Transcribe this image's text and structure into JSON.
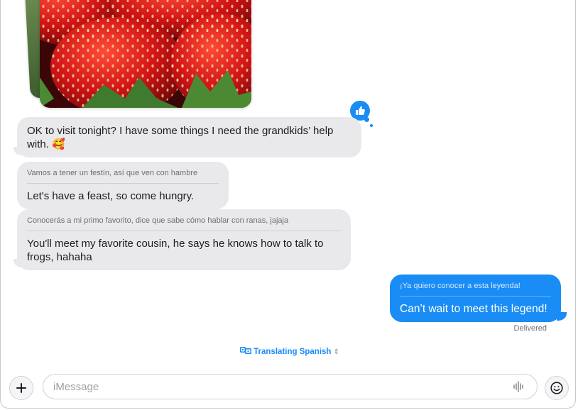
{
  "conversation": {
    "messages": [
      {
        "direction": "incoming",
        "text": "OK to visit tonight? I have some things I need the grandkids’ help with.",
        "emoji": "🥰"
      },
      {
        "direction": "incoming",
        "original": "Vamos a tener un festín, así que ven con hambre",
        "translation": "Let's have a feast, so come hungry."
      },
      {
        "direction": "incoming",
        "original": "Conocerás a mi primo favorito, dice que sabe cómo hablar con ranas, jajaja",
        "translation": "You'll meet my favorite cousin, he says he knows how to talk to frogs, hahaha"
      },
      {
        "direction": "outgoing",
        "original": "¡Ya quiero conocer a esta leyenda!",
        "translation": "Can’t wait to meet this legend!"
      }
    ],
    "tapback": "thumbs-up-icon",
    "status": "Delivered",
    "translation_indicator": "Translating Spanish"
  },
  "composer": {
    "placeholder": "iMessage"
  },
  "colors": {
    "accent": "#1a8cf5",
    "incoming_bubble": "#e9e9eb",
    "outgoing_bubble": "#1a8cf5"
  }
}
